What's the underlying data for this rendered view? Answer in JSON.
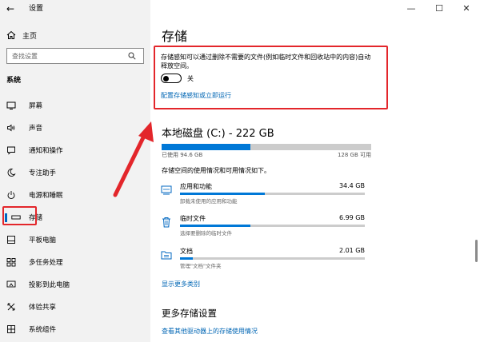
{
  "window": {
    "back_glyph": "←",
    "title": "设置",
    "controls": {
      "minimize": "—",
      "maximize": "☐",
      "close": "✕"
    }
  },
  "sidebar": {
    "home_label": "主页",
    "search_placeholder": "查找设置",
    "section_heading": "系统",
    "items": [
      {
        "label": "屏幕",
        "icon": "monitor-icon"
      },
      {
        "label": "声音",
        "icon": "speaker-icon"
      },
      {
        "label": "通知和操作",
        "icon": "notification-icon"
      },
      {
        "label": "专注助手",
        "icon": "moon-icon"
      },
      {
        "label": "电源和睡眠",
        "icon": "power-icon"
      },
      {
        "label": "存储",
        "icon": "storage-icon",
        "selected": true
      },
      {
        "label": "平板电脑",
        "icon": "tablet-icon"
      },
      {
        "label": "多任务处理",
        "icon": "multitask-icon"
      },
      {
        "label": "投影到此电脑",
        "icon": "project-icon"
      },
      {
        "label": "体验共享",
        "icon": "share-icon"
      },
      {
        "label": "系统组件",
        "icon": "components-icon"
      }
    ]
  },
  "main": {
    "title": "存储",
    "storage_sense": {
      "description": "存储感知可以通过删除不需要的文件(例如临时文件和回收站中的内容)自动释放空间。",
      "toggle_state": "关",
      "toggle_on": false,
      "config_link": "配置存储感知或立即运行"
    },
    "disk": {
      "title": "本地磁盘 (C:) - 222 GB",
      "used_label": "已使用 94.6 GB",
      "total_label": "128 GB 可用",
      "used_fraction": 0.425,
      "description": "存储空间的使用情况和可用情况如下。"
    },
    "categories": [
      {
        "name": "应用和功能",
        "size": "34.4 GB",
        "sub": "卸载未使用的应用和功能",
        "fraction": 0.46,
        "icon": "apps-icon"
      },
      {
        "name": "临时文件",
        "size": "6.99 GB",
        "sub": "选择要删除的临时文件",
        "fraction": 0.38,
        "icon": "trash-icon"
      },
      {
        "name": "文档",
        "size": "2.01 GB",
        "sub": "管理\"文档\"文件夹",
        "fraction": 0.07,
        "icon": "documents-folder-icon"
      }
    ],
    "show_more_link": "显示更多类别",
    "more_settings_title": "更多存储设置",
    "more_settings_link": "查看其他驱动器上的存储使用情况"
  },
  "colors": {
    "accent": "#0078d7",
    "link": "#0066b4",
    "annotation_red": "#e3262b",
    "sidebar_bg": "#f2f2f2",
    "bar_track": "#cccccc"
  }
}
